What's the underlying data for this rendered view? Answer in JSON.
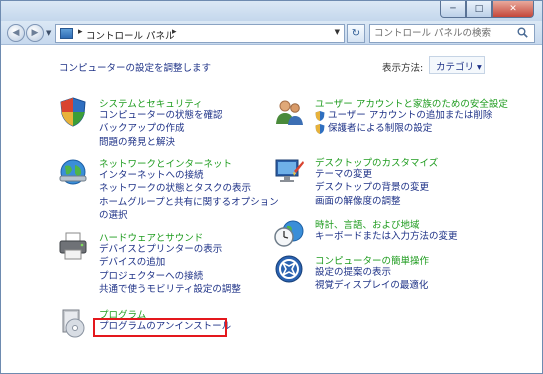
{
  "window": {
    "controls": {
      "minimize": "─",
      "maximize": "□",
      "close": "✕"
    }
  },
  "nav": {
    "back": "◀",
    "forward": "▶",
    "dropdown": "▼",
    "address": {
      "separator": "▸",
      "path": "コントロール パネル",
      "dropdown": "▼"
    },
    "refresh": "↻",
    "search_placeholder": "コントロール パネルの検索"
  },
  "header": {
    "title": "コンピューターの設定を調整します",
    "view_by_label": "表示方法:",
    "view_by_value": "カテゴリ ▾"
  },
  "categories": {
    "system": {
      "icon": "system-security-shield-icon",
      "title": "システムとセキュリティ",
      "links": [
        "コンピューターの状態を確認",
        "バックアップの作成",
        "問題の発見と解決"
      ]
    },
    "network": {
      "icon": "network-globe-icon",
      "title": "ネットワークとインターネット",
      "links": [
        "インターネットへの接続",
        "ネットワークの状態とタスクの表示",
        "ホームグループと共有に関するオプション",
        "の選択"
      ]
    },
    "hardware": {
      "icon": "printer-hardware-icon",
      "title": "ハードウェアとサウンド",
      "links": [
        "デバイスとプリンターの表示",
        "デバイスの追加",
        "プロジェクターへの接続",
        "共通で使うモビリティ設定の調整"
      ]
    },
    "programs": {
      "icon": "programs-disc-icon",
      "title": "プログラム",
      "links": [
        "プログラムのアンインストール"
      ]
    },
    "users": {
      "icon": "users-icon",
      "title": "ユーザー アカウントと家族のための安全設定",
      "links": [
        "ユーザー アカウントの追加または削除",
        "保護者による制限の設定"
      ]
    },
    "appearance": {
      "icon": "display-appearance-icon",
      "title": "デスクトップのカスタマイズ",
      "links": [
        "テーマの変更",
        "デスクトップの背景の変更",
        "画面の解像度の調整"
      ]
    },
    "clock": {
      "icon": "clock-globe-icon",
      "title": "時計、言語、および地域",
      "links": [
        "キーボードまたは入力方法の変更"
      ]
    },
    "ease": {
      "icon": "ease-of-access-icon",
      "title": "コンピューターの簡単操作",
      "links": [
        "設定の提案の表示",
        "視覚ディスプレイの最適化"
      ]
    }
  },
  "colors": {
    "category_title": "#1f9c1f",
    "link": "#1e3287",
    "highlight": "#e4181d"
  }
}
